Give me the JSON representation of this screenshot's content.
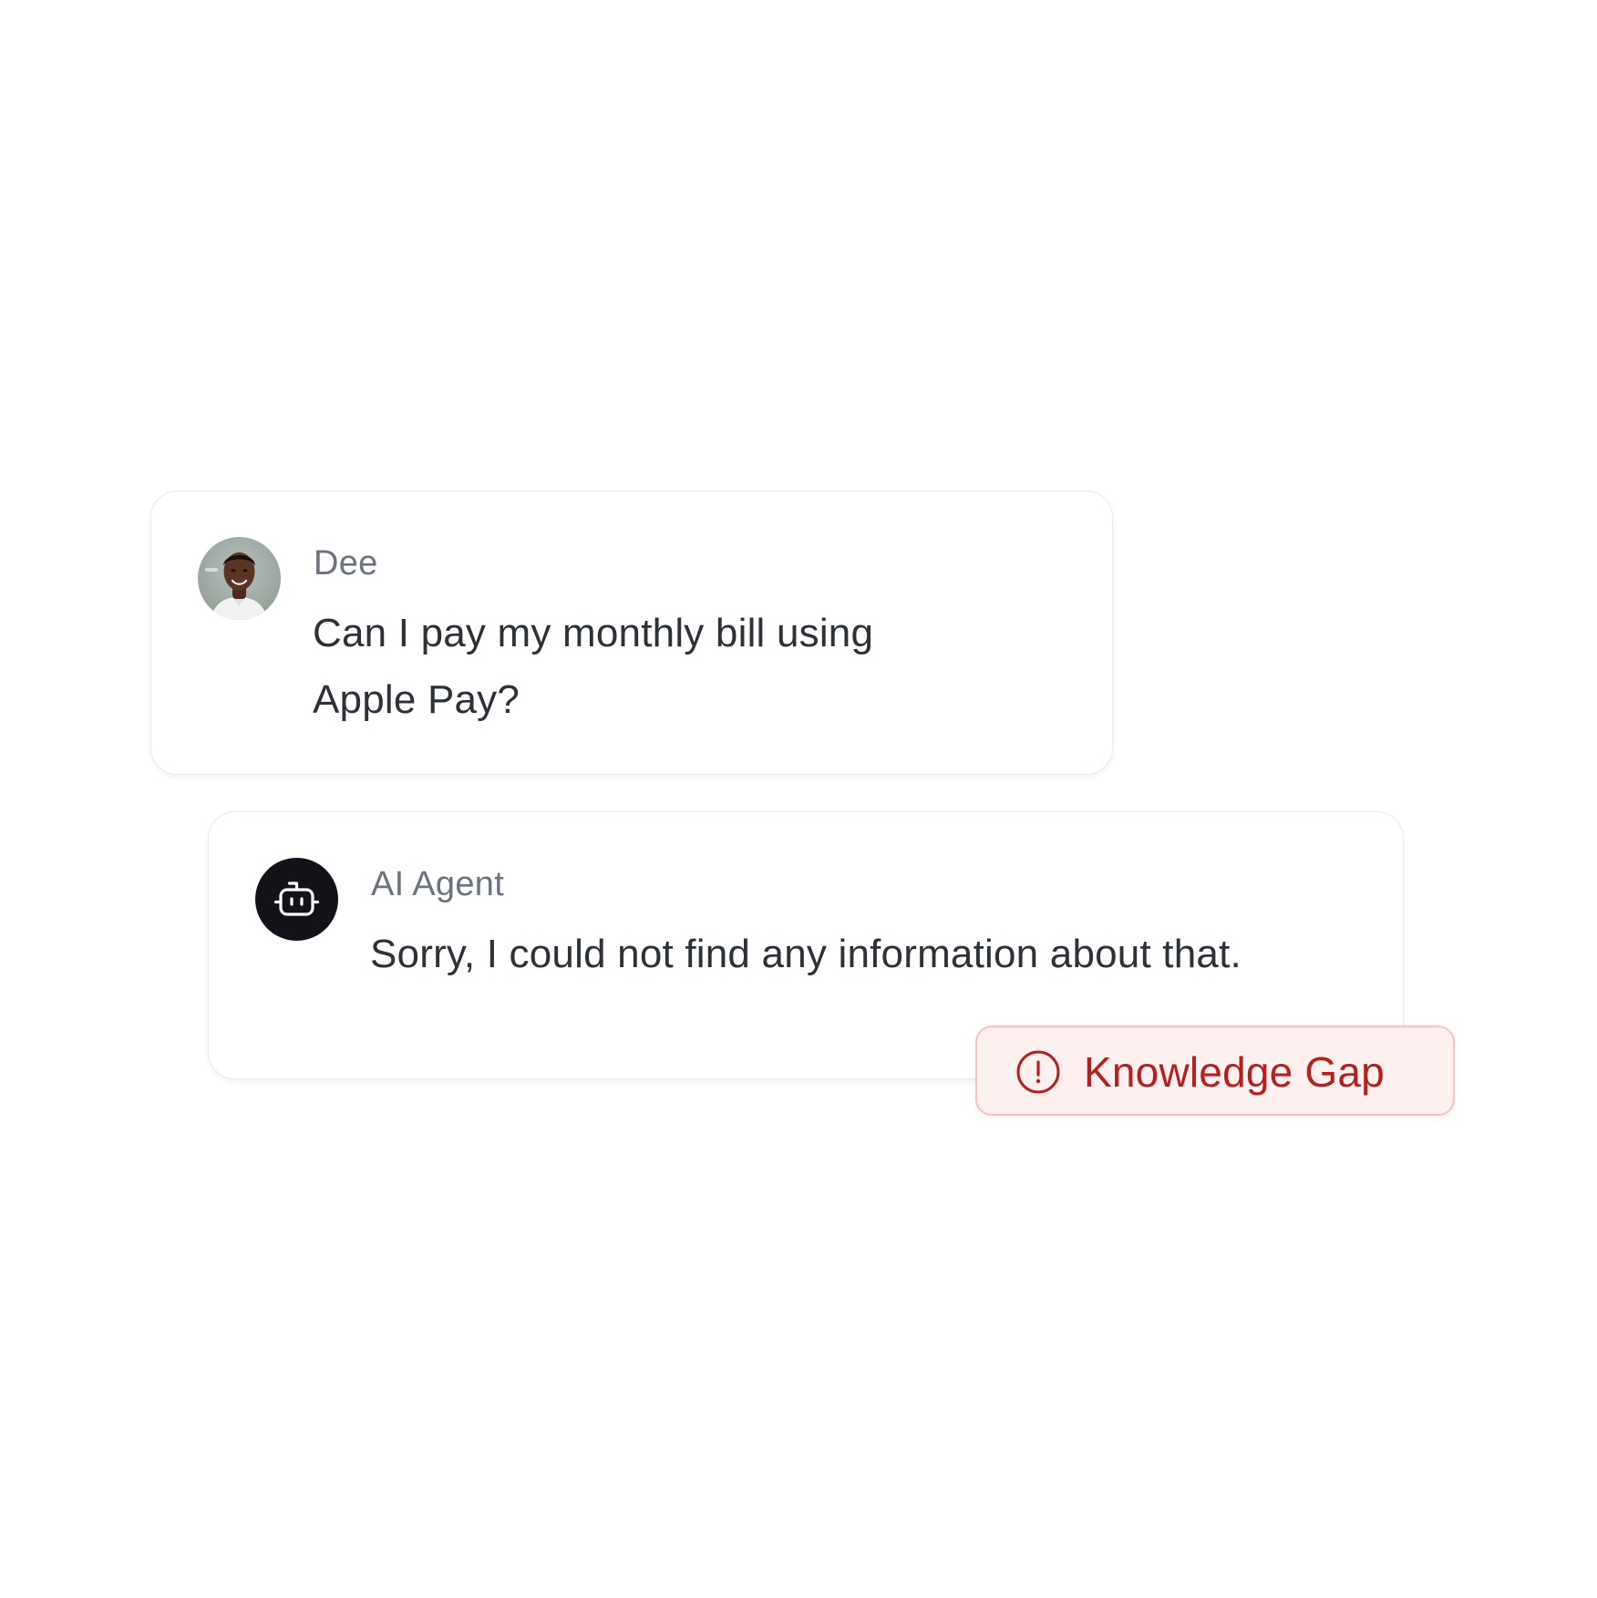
{
  "messages": [
    {
      "sender": "Dee",
      "avatar": "user-avatar-photo",
      "text_lines": [
        "Can I pay my monthly bill using",
        "Apple Pay?"
      ]
    },
    {
      "sender": "AI Agent",
      "avatar": "robot-icon",
      "text_lines": [
        "Sorry, I could not find any information about that."
      ]
    }
  ],
  "badge": {
    "icon": "alert-circle-icon",
    "label": "Knowledge Gap"
  },
  "colors": {
    "background": "#ffffff",
    "card_border": "#e9eaec",
    "sender_text": "#6b7280",
    "message_text": "#2d3239",
    "agent_avatar_bg": "#111318",
    "badge_bg": "#fef0ef",
    "badge_border": "#f6c3c1",
    "badge_text": "#b4201d"
  }
}
